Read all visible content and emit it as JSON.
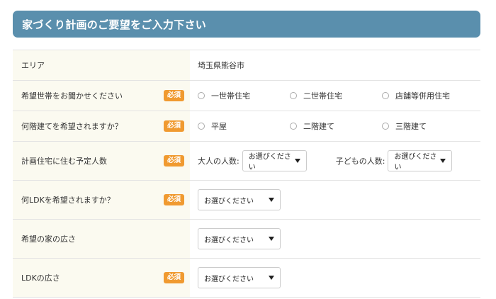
{
  "header": {
    "title": "家づくり計画のご要望をご入力下さい"
  },
  "required_badge": "必須",
  "rows": {
    "area": {
      "label": "エリア",
      "value": "埼玉県熊谷市"
    },
    "household": {
      "label": "希望世帯をお聞かせください",
      "options": [
        "一世帯住宅",
        "二世帯住宅",
        "店舗等併用住宅"
      ]
    },
    "floors": {
      "label": "何階建てを希望されますか？",
      "options": [
        "平屋",
        "二階建て",
        "三階建て"
      ]
    },
    "occupants": {
      "label": "計画住宅に住む予定人数",
      "adults_label": "大人の人数:",
      "adults_value": "お選びください",
      "children_label": "子どもの人数:",
      "children_value": "お選びください"
    },
    "ldk": {
      "label": "何LDKを希望されますか？",
      "value": "お選びください"
    },
    "house_size": {
      "label": "希望の家の広さ",
      "value": "お選びください"
    },
    "ldk_size": {
      "label": "LDKの広さ",
      "value": "お選びください"
    }
  },
  "colors": {
    "header_bg": "#5a8fad",
    "badge_bg": "#f09a30",
    "label_bg": "#fbfaf0"
  }
}
